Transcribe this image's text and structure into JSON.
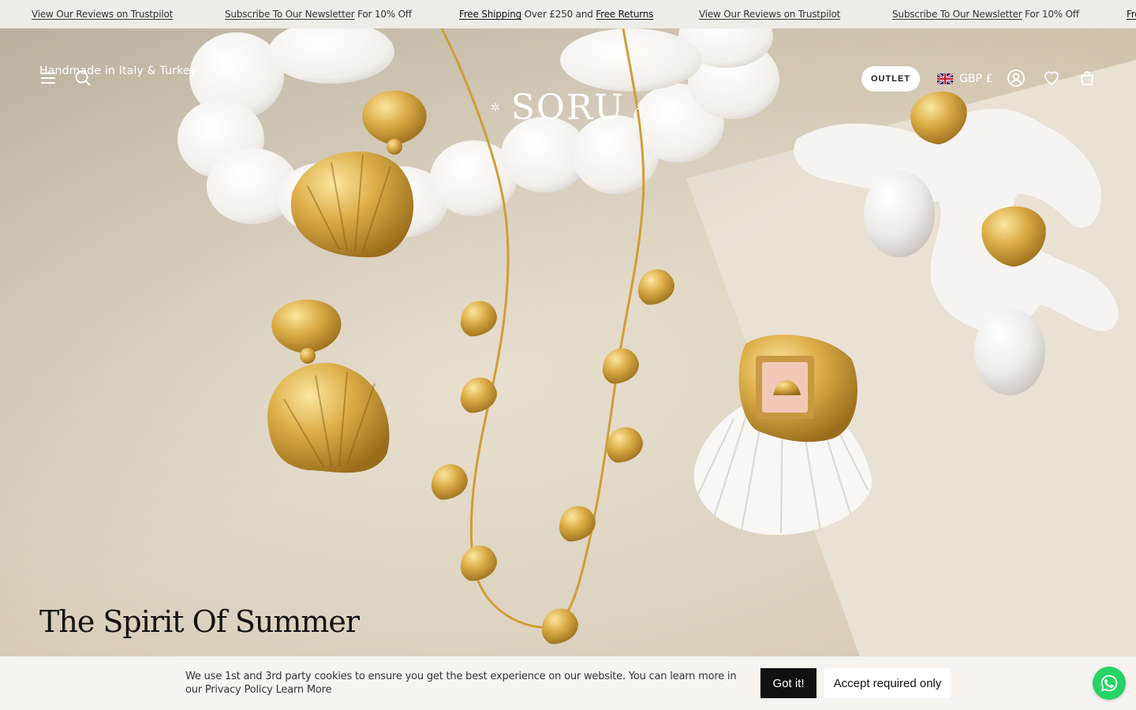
{
  "announcement": {
    "items": [
      {
        "link": "View Our Reviews on Trustpilot",
        "rest": ""
      },
      {
        "link": "Subscribe To Our Newsletter",
        "rest": " For 10% Off"
      },
      {
        "bold1": "Free Shipping",
        "mid": " Over £250 and ",
        "bold2": "Free Returns"
      },
      {
        "link": "View Our Reviews on Trustpilot",
        "rest": ""
      },
      {
        "link": "Subscribe To Our Newsletter",
        "rest": " For 10% Off"
      },
      {
        "partial": "Fre"
      }
    ]
  },
  "header": {
    "tagline": "Handmade in Italy & Turkey",
    "logo": "SORU",
    "outlet_label": "OUTLET",
    "currency": "GBP £",
    "icons": [
      "menu-icon",
      "search-icon",
      "account-icon",
      "wishlist-heart-icon",
      "cart-bag-icon"
    ]
  },
  "hero": {
    "title": "The Spirit Of Summer"
  },
  "cookie_bar": {
    "text": "We use 1st and 3rd party cookies to ensure you get the best experience on our website. You can learn more in our Privacy Policy Learn More",
    "accept_label": "Got it!",
    "required_label": "Accept required only"
  },
  "colors": {
    "accent_dark": "#111111",
    "whatsapp": "#25d366",
    "gold": "#d4a53a"
  }
}
